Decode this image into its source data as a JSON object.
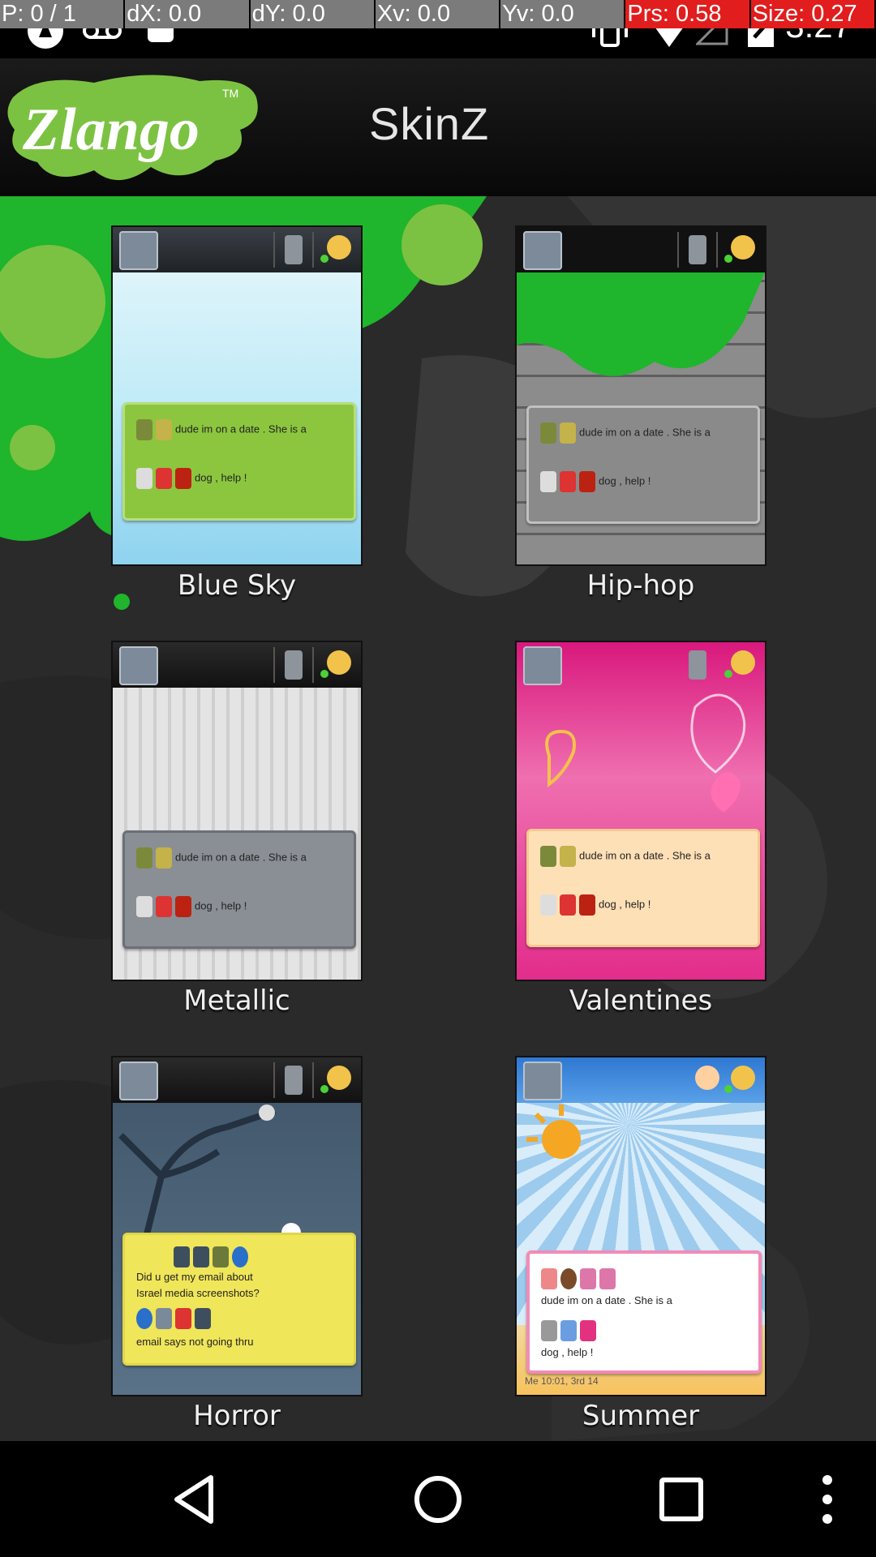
{
  "debug": [
    "P: 0 / 1",
    "dX: 0.0",
    "dY: 0.0",
    "Xv: 0.0",
    "Yv: 0.0",
    "Prs: 0.58",
    "Size: 0.27"
  ],
  "status": {
    "time": "3:27"
  },
  "header": {
    "logo_text": "Zlango",
    "title": "SkinZ"
  },
  "skins": [
    {
      "label": "Blue Sky"
    },
    {
      "label": "Hip-hop"
    },
    {
      "label": "Metallic"
    },
    {
      "label": "Valentines"
    },
    {
      "label": "Horror"
    },
    {
      "label": "Summer"
    }
  ],
  "bubble_text": {
    "line1": "dude  im  on a date .  She is a",
    "line2": "dog ,  help  !",
    "horror1": "Did  u  get  my  email about",
    "horror2": "Israel media screenshots?",
    "horror3": "email  says  not  going  thru",
    "summer_footer": "Me 10:01, 3rd 14"
  },
  "colors": {
    "brand_green": "#7cc242",
    "accent_green": "#1fb52c"
  },
  "icons": [
    "back-icon",
    "home-icon",
    "recents-icon",
    "overflow-menu-icon"
  ]
}
